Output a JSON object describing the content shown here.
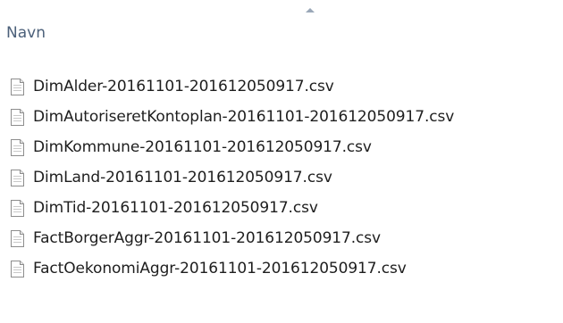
{
  "column": {
    "name_label": "Navn",
    "sort_direction": "ascending"
  },
  "files": [
    {
      "name": "DimAlder-20161101-201612050917.csv",
      "icon": "text-file-icon"
    },
    {
      "name": "DimAutoriseretKontoplan-20161101-201612050917.csv",
      "icon": "text-file-icon"
    },
    {
      "name": "DimKommune-20161101-201612050917.csv",
      "icon": "text-file-icon"
    },
    {
      "name": "DimLand-20161101-201612050917.csv",
      "icon": "text-file-icon"
    },
    {
      "name": "DimTid-20161101-201612050917.csv",
      "icon": "text-file-icon"
    },
    {
      "name": "FactBorgerAggr-20161101-201612050917.csv",
      "icon": "text-file-icon"
    },
    {
      "name": "FactOekonomiAggr-20161101-201612050917.csv",
      "icon": "text-file-icon"
    }
  ],
  "colors": {
    "header_text": "#4c607a",
    "file_text": "#1e1e1e",
    "sort_arrow": "#9aa7b8",
    "background": "#ffffff"
  }
}
